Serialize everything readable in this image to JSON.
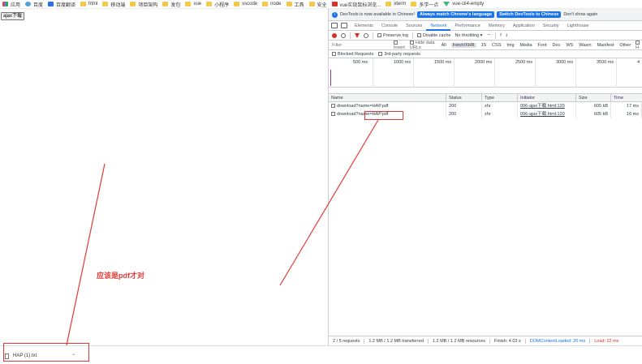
{
  "bookmarks": [
    {
      "label": "应用",
      "icon": "apps-grid-icon",
      "kind": "grid"
    },
    {
      "label": "百度",
      "icon": "globe-icon",
      "kind": "globe"
    },
    {
      "label": "百度翻译",
      "icon": "translate-icon",
      "kind": "blue"
    },
    {
      "label": "html",
      "icon": "folder-icon",
      "kind": "folder"
    },
    {
      "label": "移动端",
      "icon": "folder-icon",
      "kind": "folder"
    },
    {
      "label": "项目架构",
      "icon": "folder-icon",
      "kind": "folder"
    },
    {
      "label": "发包",
      "icon": "folder-icon",
      "kind": "folder"
    },
    {
      "label": "vue",
      "icon": "folder-icon",
      "kind": "folder"
    },
    {
      "label": "小程序",
      "icon": "folder-icon",
      "kind": "folder"
    },
    {
      "label": "vscode",
      "icon": "folder-icon",
      "kind": "folder"
    },
    {
      "label": "node",
      "icon": "folder-icon",
      "kind": "folder"
    },
    {
      "label": "工具",
      "icon": "folder-icon",
      "kind": "folder"
    },
    {
      "label": "安全",
      "icon": "folder-icon",
      "kind": "folder"
    },
    {
      "label": "vue实现鼠标浏览...",
      "icon": "site-icon",
      "kind": "red"
    },
    {
      "label": "xterm",
      "icon": "folder-icon",
      "kind": "folder"
    },
    {
      "label": "多学一点",
      "icon": "folder-icon",
      "kind": "folder"
    },
    {
      "label": "vue-cli4-empty",
      "icon": "vue-icon",
      "kind": "vue"
    }
  ],
  "page": {
    "ajax_button": "ajax下载"
  },
  "devtools": {
    "infobar": {
      "text": "DevTools is now available in Chinese!",
      "btn_match": "Always match Chrome's language",
      "btn_switch": "Switch DevTools to Chinese",
      "btn_dismiss": "Don't show again"
    },
    "tabs": [
      "Elements",
      "Console",
      "Sources",
      "Network",
      "Performance",
      "Memory",
      "Application",
      "Security",
      "Lighthouse"
    ],
    "active_tab": "Network",
    "toolbar": {
      "preserve_log": "Preserve log",
      "disable_cache": "Disable cache",
      "throttling": "No throttling"
    },
    "filter": {
      "placeholder": "Filter",
      "invert": "Invert",
      "hide_data_urls": "Hide data URLs",
      "types": [
        "All",
        "Fetch/XHR",
        "JS",
        "CSS",
        "Img",
        "Media",
        "Font",
        "Doc",
        "WS",
        "Wasm",
        "Manifest",
        "Other"
      ],
      "selected_type": "Fetch/XHR",
      "has_blocked": "H"
    },
    "blocked": {
      "blocked_requests": "Blocked Requests",
      "third_party": "3rd-party requests"
    },
    "timeline_ticks": [
      "500 ms",
      "1000 ms",
      "1500 ms",
      "2000 ms",
      "2500 ms",
      "3000 ms",
      "3500 ms",
      "4"
    ],
    "columns": {
      "name": "Name",
      "status": "Status",
      "type": "Type",
      "initiator": "Initiator",
      "size": "Size",
      "time": "Time"
    },
    "rows": [
      {
        "name": "download?name=HAP.pdf",
        "status": "200",
        "type": "xhr",
        "initiator": "006-ajax下载.html:120",
        "size": "605 kB",
        "time": "17 ms"
      },
      {
        "name": "download?name=HAP.pdf",
        "status": "200",
        "type": "xhr",
        "initiator": "006-ajax下载.html:120",
        "size": "605 kB",
        "time": "16 ms"
      }
    ],
    "statusbar": {
      "requests": "2 / 5 requests",
      "transferred": "1.2 MB / 1.2 MB transferred",
      "resources": "1.2 MB / 1.2 MB resources",
      "finish": "Finish: 4.03 s",
      "dcl": "DOMContentLoaded: 20 ms",
      "load": "Load: 22 ms"
    }
  },
  "download": {
    "filename": "HAP (1).txt"
  },
  "annotation": {
    "text": "应该是pdf才对"
  },
  "colors": {
    "accent": "#1a73e8",
    "annotation": "#e53935"
  }
}
